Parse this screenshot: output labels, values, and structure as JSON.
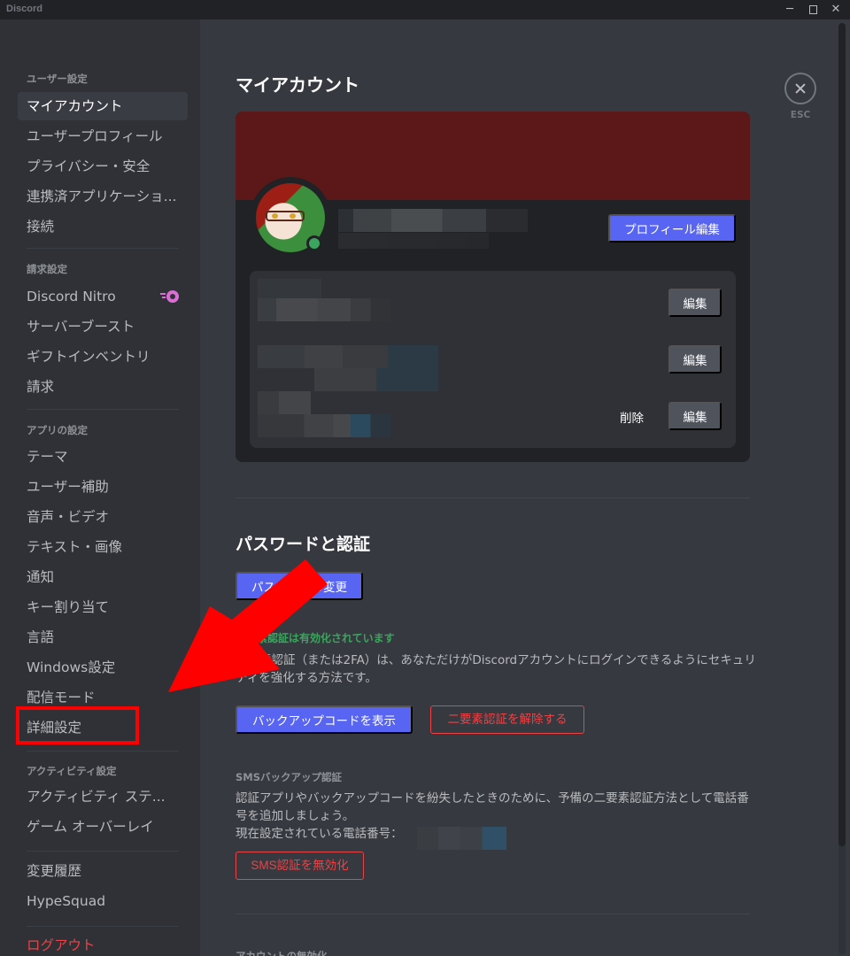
{
  "window": {
    "app_name": "Discord",
    "controls": {
      "minimize": "─",
      "close": "✕"
    }
  },
  "sidebar": {
    "sections": [
      {
        "header": "ユーザー設定",
        "items": [
          {
            "label": "マイアカウント",
            "active": true
          },
          {
            "label": "ユーザープロフィール"
          },
          {
            "label": "プライバシー・安全"
          },
          {
            "label": "連携済アプリケーショ..."
          },
          {
            "label": "接続"
          }
        ]
      },
      {
        "header": "請求設定",
        "items": [
          {
            "label": "Discord Nitro",
            "icon": "nitro-icon"
          },
          {
            "label": "サーバーブースト"
          },
          {
            "label": "ギフトインベントリ"
          },
          {
            "label": "請求"
          }
        ]
      },
      {
        "header": "アプリの設定",
        "items": [
          {
            "label": "テーマ"
          },
          {
            "label": "ユーザー補助"
          },
          {
            "label": "音声・ビデオ"
          },
          {
            "label": "テキスト・画像"
          },
          {
            "label": "通知"
          },
          {
            "label": "キー割り当て"
          },
          {
            "label": "言語"
          },
          {
            "label": "Windows設定"
          },
          {
            "label": "配信モード"
          },
          {
            "label": "詳細設定",
            "highlighted": true
          }
        ]
      },
      {
        "header": "アクティビティ設定",
        "items": [
          {
            "label": "アクティビティ ステ..."
          },
          {
            "label": "ゲーム オーバーレイ"
          }
        ]
      },
      {
        "header": "",
        "items": [
          {
            "label": "変更履歴"
          },
          {
            "label": "HypeSquad"
          }
        ]
      },
      {
        "header": "",
        "items": [
          {
            "label": "ログアウト",
            "danger": true
          }
        ]
      }
    ]
  },
  "main": {
    "title": "マイアカウント",
    "close_label": "ESC",
    "profile": {
      "edit_profile_button": "プロフィール編集",
      "status": "online",
      "banner_color": "#5c1818",
      "fields": [
        {
          "edit_button": "編集"
        },
        {
          "edit_button": "編集"
        },
        {
          "edit_button": "編集",
          "delete_link": "削除"
        }
      ]
    },
    "password_section": {
      "title": "パスワードと認証",
      "change_password_button": "パスワードの変更",
      "tfa_enabled_text": "二要素認証は有効化されています",
      "tfa_description": "二要素認証（または2FA）は、あなただけがDiscordアカウントにログインできるようにセキュリティを強化する方法です。",
      "view_backup_codes_button": "バックアップコードを表示",
      "remove_2fa_button": "二要素認証を解除する",
      "sms_title": "SMSバックアップ認証",
      "sms_description": "認証アプリやバックアップコードを紛失したときのために、予備の二要素認証方法として電話番号を追加しましょう。",
      "phone_label": "現在設定されている電話番号：",
      "disable_sms_button": "SMS認証を無効化"
    },
    "deactivate_title": "アカウントの無効化"
  },
  "colors": {
    "accent": "#5865f2",
    "danger": "#ed4245",
    "success": "#3ba55d",
    "annotation": "#ff0000"
  }
}
